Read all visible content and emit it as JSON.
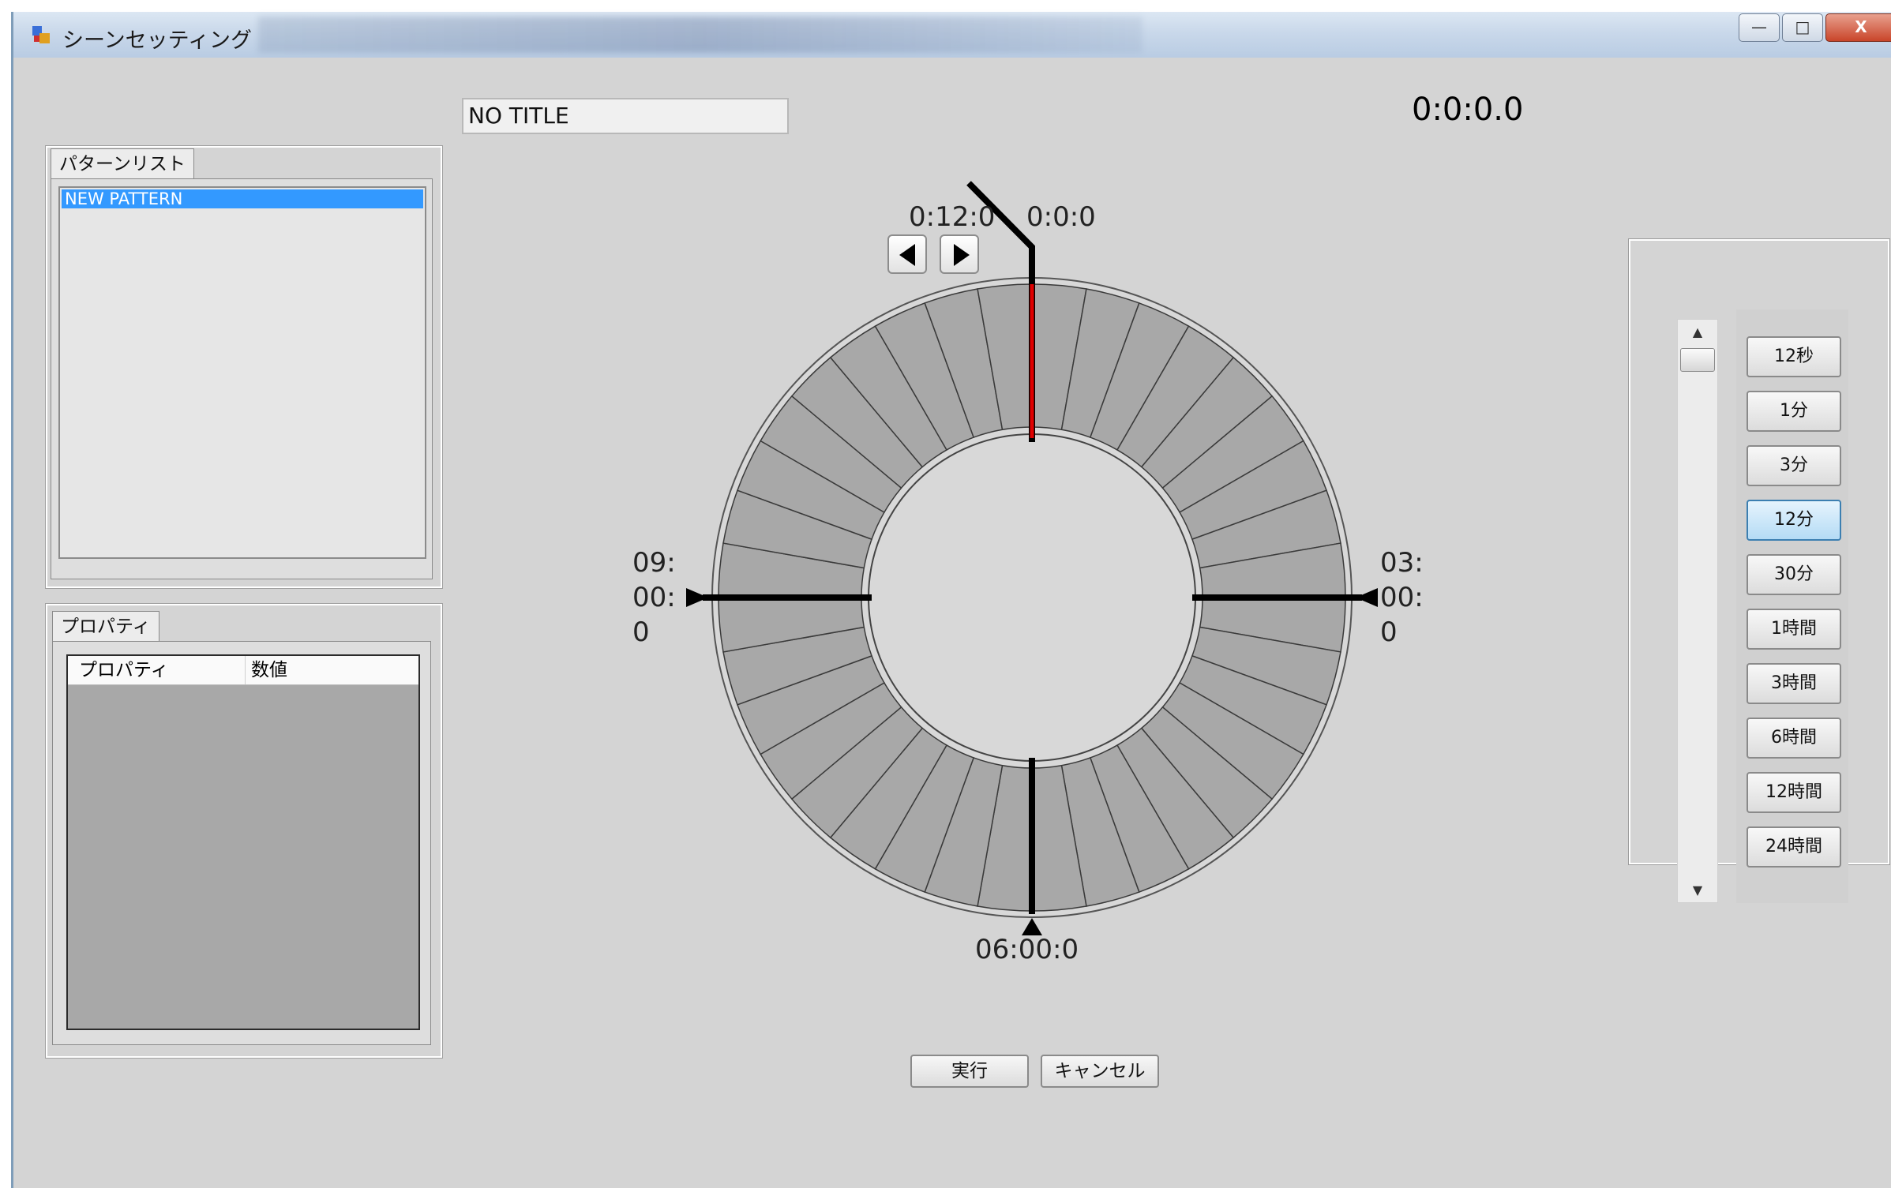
{
  "window": {
    "title": "シーンセッティング",
    "controls": {
      "minimize": "▭",
      "maximize": "□",
      "close": "X"
    }
  },
  "pattern_list": {
    "tab_label": "パターンリスト",
    "items": [
      "NEW PATTERN"
    ],
    "selected": "NEW PATTERN"
  },
  "properties": {
    "tab_label": "プロパティ",
    "columns": [
      "プロパティ",
      "数値"
    ]
  },
  "scene": {
    "title": "NO TITLE",
    "time_readout": "0:0:0.0"
  },
  "dial": {
    "top_left_label": "0:12:0",
    "top_right_label": "0:0:0",
    "right_label": [
      "03:",
      "00:",
      "0"
    ],
    "left_label": [
      "09:",
      "00:",
      "0"
    ],
    "bottom_label": "06:00:0",
    "segments": 36
  },
  "actions": {
    "run": "実行",
    "cancel": "キャンセル"
  },
  "scale_buttons": {
    "labels": [
      "12秒",
      "1分",
      "3分",
      "12分",
      "30分",
      "1時間",
      "3時間",
      "6時間",
      "12時間",
      "24時間"
    ],
    "active": "12分"
  },
  "scrollbar": {
    "up": "▲",
    "down": "▼"
  }
}
